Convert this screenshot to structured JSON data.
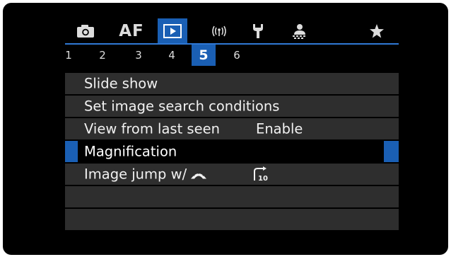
{
  "tabs": [
    {
      "name": "camera-icon"
    },
    {
      "label": "AF"
    },
    {
      "name": "playback-icon"
    },
    {
      "label": "((ı))",
      "name": "wireless-icon"
    },
    {
      "name": "wrench-icon"
    },
    {
      "name": "camera-person-icon"
    },
    {
      "name": "star-icon"
    }
  ],
  "pages": [
    "1",
    "2",
    "3",
    "4",
    "5",
    "6"
  ],
  "active_page": "5",
  "menu": {
    "items": [
      {
        "label": "Slide show"
      },
      {
        "label": "Set image search conditions"
      },
      {
        "label": "View from last seen",
        "value": "Enable"
      },
      {
        "label": "Magnification",
        "selected": true
      },
      {
        "label": "Image jump w/",
        "icon": "main-dial-icon",
        "value_icon": "jump-10-images-icon",
        "value_icon_text": "10"
      }
    ],
    "empty_rows": 2
  },
  "colors": {
    "accent": "#1a5fb4",
    "row_bg": "#2e2e2e",
    "screen_bg": "#000000",
    "text": "#f2f2f2"
  }
}
